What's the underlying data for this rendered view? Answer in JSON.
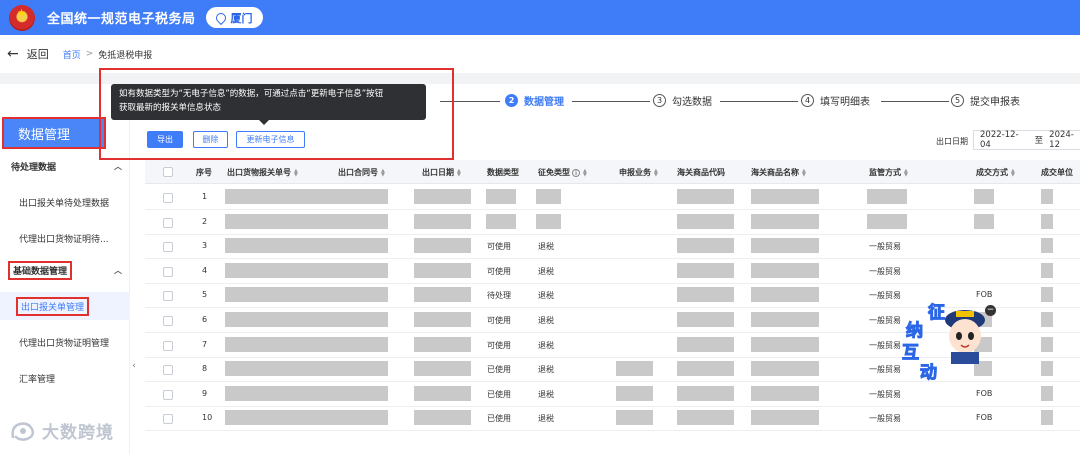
{
  "header": {
    "title": "全国统一规范电子税务局",
    "city": "厦门",
    "brand_color": "#3f7cf7"
  },
  "breadcrumb": {
    "back_label": "返回",
    "home": "首页",
    "separator": ">",
    "current": "免抵退税申报"
  },
  "sidebar": {
    "title": "数据管理",
    "groups": [
      {
        "label": "待处理数据",
        "items": [
          "出口报关单待处理数据",
          "代理出口货物证明待..."
        ]
      },
      {
        "label": "基础数据管理",
        "items": [
          "出口报关单管理",
          "代理出口货物证明管理",
          "汇率管理"
        ]
      }
    ]
  },
  "steps": [
    {
      "num": "2",
      "label": "数据管理",
      "active": true
    },
    {
      "num": "3",
      "label": "勾选数据",
      "active": false
    },
    {
      "num": "4",
      "label": "填写明细表",
      "active": false
    },
    {
      "num": "5",
      "label": "提交申报表",
      "active": false
    }
  ],
  "tooltip": {
    "line1": "如有数据类型为“无电子信息”的数据，可通过点击“更新电子信息”按钮",
    "line2": "获取最新的报关单信息状态"
  },
  "toolbar": {
    "export_label": "导出",
    "delete_label": "删除",
    "update_label": "更新电子信息"
  },
  "filter": {
    "date_label": "出口日期",
    "date_start": "2022-12-04",
    "to_label": "至",
    "date_end": "2024-12"
  },
  "table": {
    "columns": [
      "序号",
      "出口货物报关单号",
      "出口合同号",
      "出口日期",
      "数据类型",
      "征免类型",
      "申报业务",
      "海关商品代码",
      "海关商品名称",
      "监管方式",
      "成交方式",
      "成交单位"
    ],
    "rows": [
      {
        "seq": "1",
        "data_type": "",
        "exempt_type": "",
        "supervision": "",
        "deal": ""
      },
      {
        "seq": "2",
        "data_type": "",
        "exempt_type": "",
        "supervision": "",
        "deal": ""
      },
      {
        "seq": "3",
        "data_type": "可使用",
        "exempt_type": "退税",
        "supervision": "一般贸易",
        "deal": ""
      },
      {
        "seq": "4",
        "data_type": "可使用",
        "exempt_type": "退税",
        "supervision": "一般贸易",
        "deal": ""
      },
      {
        "seq": "5",
        "data_type": "待处理",
        "exempt_type": "退税",
        "supervision": "一般贸易",
        "deal": "FOB"
      },
      {
        "seq": "6",
        "data_type": "可使用",
        "exempt_type": "退税",
        "supervision": "一般贸易",
        "deal": ""
      },
      {
        "seq": "7",
        "data_type": "可使用",
        "exempt_type": "退税",
        "supervision": "一般贸易",
        "deal": ""
      },
      {
        "seq": "8",
        "data_type": "已使用",
        "exempt_type": "退税",
        "supervision": "一般贸易",
        "deal": "FOB"
      },
      {
        "seq": "9",
        "data_type": "已使用",
        "exempt_type": "退税",
        "supervision": "一般贸易",
        "deal": "FOB"
      },
      {
        "seq": "10",
        "data_type": "已使用",
        "exempt_type": "退税",
        "supervision": "一般贸易",
        "deal": "FOB"
      }
    ]
  },
  "mascot": {
    "chars": [
      "征",
      "纳",
      "互",
      "动"
    ]
  },
  "watermark": {
    "text": "大数跨境"
  }
}
